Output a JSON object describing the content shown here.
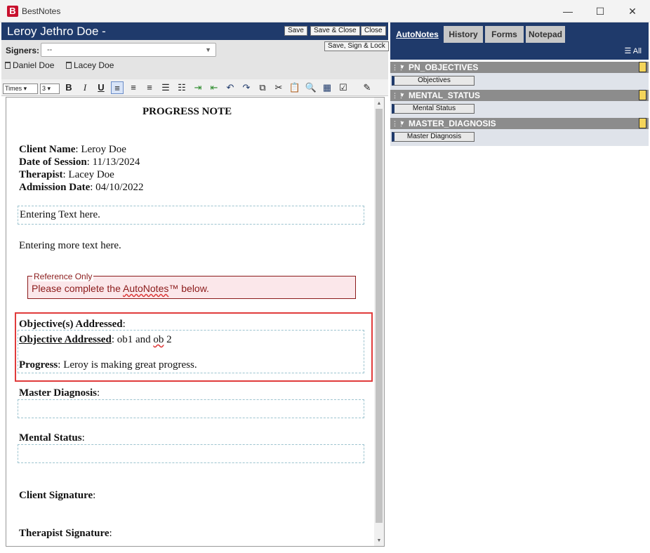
{
  "window": {
    "app_title": "BestNotes",
    "logo_letter": "B",
    "minimize": "—",
    "maximize": "☐",
    "close": "✕"
  },
  "header": {
    "patient_name": "Leroy Jethro Doe -",
    "save_label": "Save",
    "save_close_label": "Save & Close",
    "close_label": "Close",
    "save_sign_lock_label": "Save, Sign & Lock"
  },
  "signers": {
    "label": "Signers:",
    "selected": "--",
    "list": [
      "Daniel Doe",
      "Lacey Doe"
    ]
  },
  "toolbar": {
    "font_family": "Times",
    "font_size": "3"
  },
  "document": {
    "title": "PROGRESS NOTE",
    "fields": [
      {
        "label": "Client Name",
        "value": ": Leroy Doe"
      },
      {
        "label": "Date of Session",
        "value": ":  11/13/2024"
      },
      {
        "label": "Therapist",
        "value": ":  Lacey Doe"
      },
      {
        "label": "Admission Date",
        "value": ":  04/10/2022"
      }
    ],
    "text_box_1": "Entering Text here.",
    "text_2": "Entering more text here.",
    "reference": {
      "legend": "Reference Only",
      "text_before": "Please complete the ",
      "text_squiggle": "AutoNotes",
      "text_after": "™ below."
    },
    "objectives": {
      "heading": "Objective(s) Addressed",
      "heading_colon": ":",
      "addressed_label": "Objective Addressed",
      "addressed_value_before": ": ob1 and ",
      "addressed_value_squiggle": "ob",
      "addressed_value_after": " 2",
      "progress_label": "Progress",
      "progress_value": ": Leroy is making great progress."
    },
    "master_diagnosis": "Master Diagnosis",
    "mental_status": "Mental Status",
    "client_signature": "Client Signature",
    "therapist_signature": "Therapist Signature",
    "colon": ":"
  },
  "right_panel": {
    "tabs": [
      "AutoNotes",
      "History",
      "Forms",
      "Notepad"
    ],
    "all_label": "All",
    "categories": [
      {
        "name": "PN_OBJECTIVES",
        "item": "Objectives"
      },
      {
        "name": "MENTAL_STATUS",
        "item": "Mental Status"
      },
      {
        "name": "MASTER_DIAGNOSIS",
        "item": "Master Diagnosis"
      }
    ]
  }
}
